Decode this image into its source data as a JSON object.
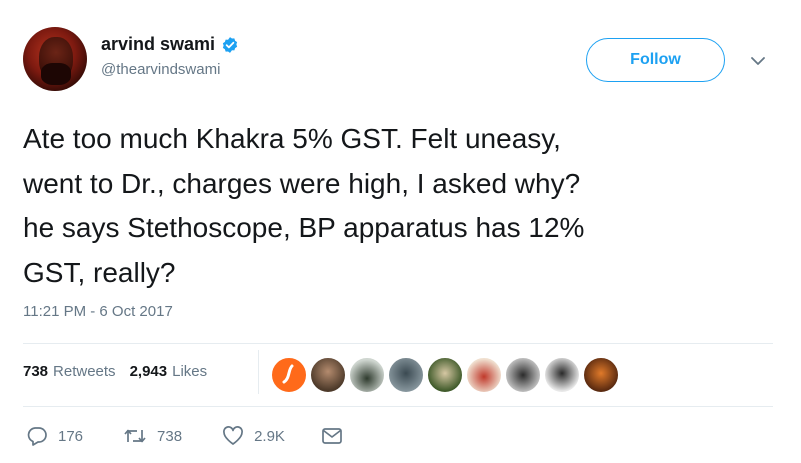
{
  "user": {
    "display_name": "arvind swami",
    "handle": "@thearvindswami",
    "verified": true
  },
  "follow_label": "Follow",
  "tweet": {
    "lines": [
      "Ate too much Khakra 5% GST. Felt uneasy,",
      "went to Dr., charges were high, I asked why?",
      "he says Stethoscope, BP apparatus has 12%",
      "GST, really?"
    ],
    "timestamp": "11:21 PM - 6 Oct 2017"
  },
  "stats": {
    "retweets_count": "738",
    "retweets_label": "Retweets",
    "likes_count": "2,943",
    "likes_label": "Likes"
  },
  "actions": {
    "reply_count": "176",
    "retweet_count": "738",
    "like_count": "2.9K"
  },
  "icons": [
    "verified-badge-icon",
    "caret-down-icon",
    "reply-icon",
    "retweet-icon",
    "heart-icon",
    "envelope-icon"
  ],
  "colors": {
    "accent": "#1da1f2",
    "text": "#14171a",
    "muted": "#657786",
    "divider": "#e6ecf0"
  }
}
